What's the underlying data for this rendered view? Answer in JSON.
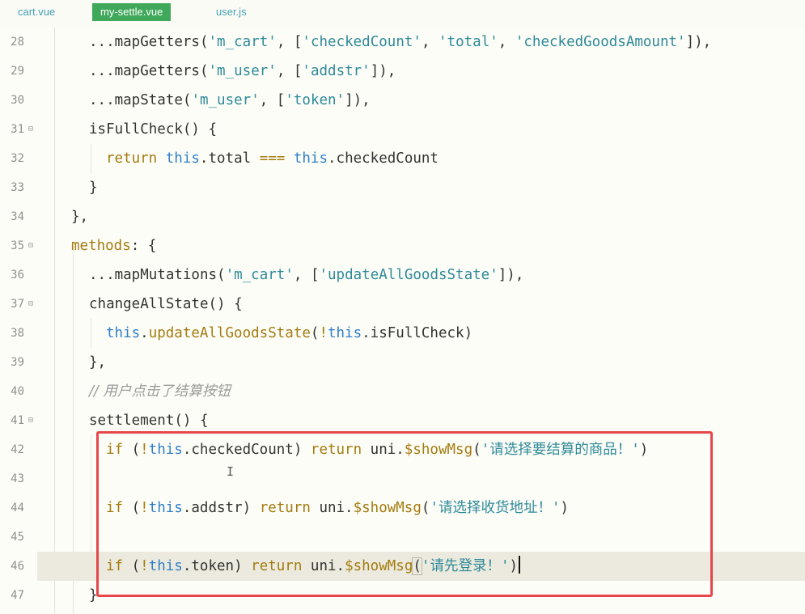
{
  "tabs": [
    {
      "label": "cart.vue",
      "active": false
    },
    {
      "label": "my-settle.vue",
      "active": true
    },
    {
      "label": "user.js",
      "active": false
    }
  ],
  "lines": [
    {
      "num": "28",
      "fold": "",
      "segments": [
        [
          "pl",
          "...mapGetters("
        ],
        [
          "str",
          "'m_cart'"
        ],
        [
          "pl",
          ", ["
        ],
        [
          "str",
          "'checkedCount'"
        ],
        [
          "pl",
          ", "
        ],
        [
          "str",
          "'total'"
        ],
        [
          "pl",
          ", "
        ],
        [
          "str",
          "'checkedGoodsAmount'"
        ],
        [
          "pl",
          "]),"
        ]
      ]
    },
    {
      "num": "29",
      "fold": "",
      "segments": [
        [
          "pl",
          "...mapGetters("
        ],
        [
          "str",
          "'m_user'"
        ],
        [
          "pl",
          ", ["
        ],
        [
          "str",
          "'addstr'"
        ],
        [
          "pl",
          "]),"
        ]
      ]
    },
    {
      "num": "30",
      "fold": "",
      "segments": [
        [
          "pl",
          "...mapState("
        ],
        [
          "str",
          "'m_user'"
        ],
        [
          "pl",
          ", ["
        ],
        [
          "str",
          "'token'"
        ],
        [
          "pl",
          "]),"
        ]
      ]
    },
    {
      "num": "31",
      "fold": "⊟",
      "segments": [
        [
          "pl",
          "isFullCheck() {"
        ]
      ]
    },
    {
      "num": "32",
      "fold": "",
      "segments": [
        [
          "kw",
          "return"
        ],
        [
          "pl",
          " "
        ],
        [
          "ths",
          "this"
        ],
        [
          "pl",
          ".total "
        ],
        [
          "op",
          "==="
        ],
        [
          "pl",
          " "
        ],
        [
          "ths",
          "this"
        ],
        [
          "pl",
          ".checkedCount"
        ]
      ]
    },
    {
      "num": "33",
      "fold": "",
      "segments": [
        [
          "pl",
          "}"
        ]
      ]
    },
    {
      "num": "34",
      "fold": "",
      "segments": [
        [
          "pl",
          "},"
        ]
      ]
    },
    {
      "num": "35",
      "fold": "⊟",
      "segments": [
        [
          "fn",
          "methods"
        ],
        [
          "pl",
          ": {"
        ]
      ]
    },
    {
      "num": "36",
      "fold": "",
      "segments": [
        [
          "pl",
          "...mapMutations("
        ],
        [
          "str",
          "'m_cart'"
        ],
        [
          "pl",
          ", ["
        ],
        [
          "str",
          "'updateAllGoodsState'"
        ],
        [
          "pl",
          "]),"
        ]
      ]
    },
    {
      "num": "37",
      "fold": "⊟",
      "segments": [
        [
          "pl",
          "changeAllState() {"
        ]
      ]
    },
    {
      "num": "38",
      "fold": "",
      "segments": [
        [
          "ths",
          "this"
        ],
        [
          "pl",
          "."
        ],
        [
          "fn",
          "updateAllGoodsState"
        ],
        [
          "pl",
          "("
        ],
        [
          "op",
          "!"
        ],
        [
          "ths",
          "this"
        ],
        [
          "pl",
          ".isFullCheck)"
        ]
      ]
    },
    {
      "num": "39",
      "fold": "",
      "segments": [
        [
          "pl",
          "},"
        ]
      ]
    },
    {
      "num": "40",
      "fold": "",
      "segments": [
        [
          "cmt",
          "// 用户点击了结算按钮"
        ]
      ]
    },
    {
      "num": "41",
      "fold": "⊟",
      "segments": [
        [
          "pl",
          "settlement() {"
        ]
      ]
    },
    {
      "num": "42",
      "fold": "",
      "segments": [
        [
          "kw",
          "if"
        ],
        [
          "pl",
          " ("
        ],
        [
          "op",
          "!"
        ],
        [
          "ths",
          "this"
        ],
        [
          "pl",
          ".checkedCount) "
        ],
        [
          "kw",
          "return"
        ],
        [
          "pl",
          " uni."
        ],
        [
          "fn",
          "$showMsg"
        ],
        [
          "pl",
          "("
        ],
        [
          "str",
          "'请选择要结算的商品！'"
        ],
        [
          "pl",
          ")"
        ]
      ]
    },
    {
      "num": "43",
      "fold": "",
      "segments": []
    },
    {
      "num": "44",
      "fold": "",
      "segments": [
        [
          "kw",
          "if"
        ],
        [
          "pl",
          " ("
        ],
        [
          "op",
          "!"
        ],
        [
          "ths",
          "this"
        ],
        [
          "pl",
          ".addstr) "
        ],
        [
          "kw",
          "return"
        ],
        [
          "pl",
          " uni."
        ],
        [
          "fn",
          "$showMsg"
        ],
        [
          "pl",
          "("
        ],
        [
          "str",
          "'请选择收货地址！'"
        ],
        [
          "pl",
          ")"
        ]
      ]
    },
    {
      "num": "45",
      "fold": "",
      "segments": []
    },
    {
      "num": "46",
      "fold": "",
      "segments": [
        [
          "kw",
          "if"
        ],
        [
          "pl",
          " ("
        ],
        [
          "op",
          "!"
        ],
        [
          "ths",
          "this"
        ],
        [
          "pl",
          ".token) "
        ],
        [
          "kw",
          "return"
        ],
        [
          "pl",
          " uni."
        ],
        [
          "fn",
          "$showMsg"
        ],
        [
          "pl",
          "("
        ],
        [
          "str",
          "'请先登录！'"
        ],
        [
          "pl",
          ")"
        ]
      ]
    },
    {
      "num": "47",
      "fold": "",
      "segments": [
        [
          "pl",
          "}"
        ]
      ]
    }
  ]
}
